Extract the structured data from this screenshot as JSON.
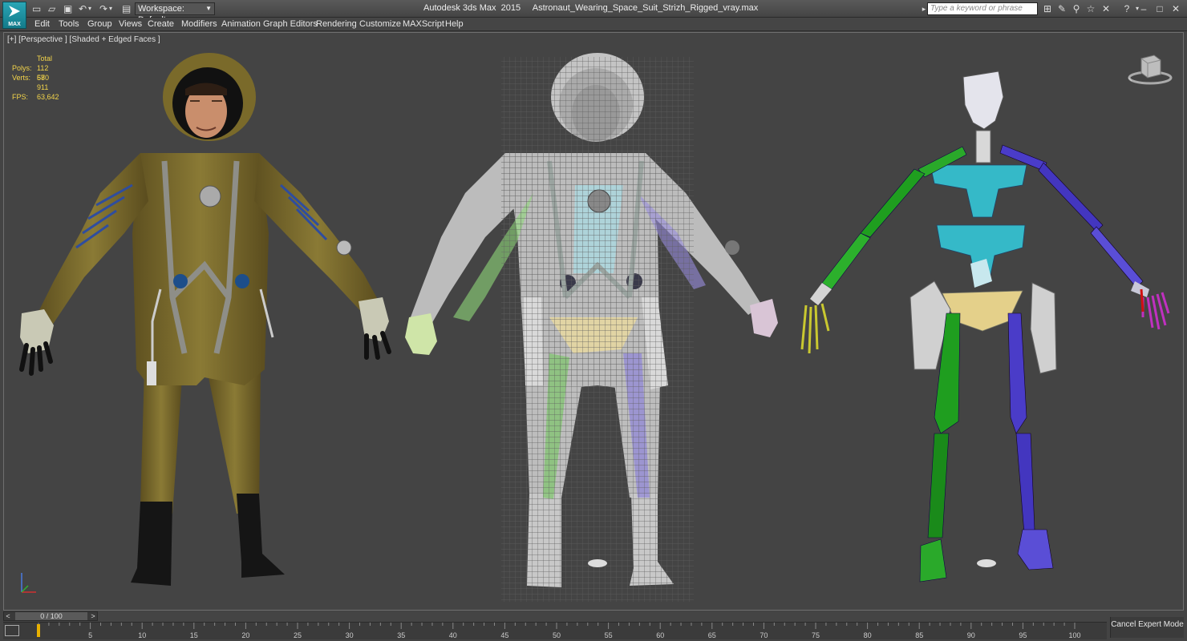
{
  "titlebar": {
    "app_logo": "MAX",
    "workspace": "Workspace: Default",
    "window_title": "Autodesk 3ds Max  2015     Astronaut_Wearing_Space_Suit_Strizh_Rigged_vray.max",
    "search_placeholder": "Type a keyword or phrase",
    "icons": [
      "new-file-icon",
      "open-file-icon",
      "save-icon",
      "undo-icon",
      "redo-icon",
      "project-folder-icon",
      "binoculars-icon",
      "tools-icon",
      "star-icon",
      "exchange-icon",
      "help-icon",
      "minimize-icon",
      "maximize-icon",
      "close-icon"
    ]
  },
  "menu": [
    "Edit",
    "Tools",
    "Group",
    "Views",
    "Create",
    "Modifiers",
    "Animation",
    "Graph Editors",
    "Rendering",
    "Customize",
    "MAXScript",
    "Help"
  ],
  "viewport": {
    "label": "[+] [Perspective ] [Shaded + Edged Faces ]",
    "stats": {
      "header": "Total",
      "polys_label": "Polys:",
      "polys": "112 680",
      "verts_label": "Verts:",
      "verts": "57 911",
      "fps_label": "FPS:",
      "fps": "63,642"
    },
    "viewcube_label": "FRONT"
  },
  "timeline": {
    "readout": "0 / 100",
    "prev": "<",
    "next": ">",
    "ticks": [
      "5",
      "10",
      "15",
      "20",
      "25",
      "30",
      "35",
      "40",
      "45",
      "50",
      "55",
      "60",
      "65",
      "70",
      "75",
      "80",
      "85",
      "90",
      "95",
      "100"
    ],
    "current_frame": 0,
    "max_frame": 100
  },
  "status": {
    "cancel_expert": "Cancel Expert Mode"
  },
  "colors": {
    "viewport_bg": "#444444",
    "stats_text": "#f3d44a",
    "bone_cyan": "#35b9c8",
    "bone_green": "#1f9e1f",
    "bone_blue": "#4a3cc8",
    "suit": "#7a6a2a"
  }
}
